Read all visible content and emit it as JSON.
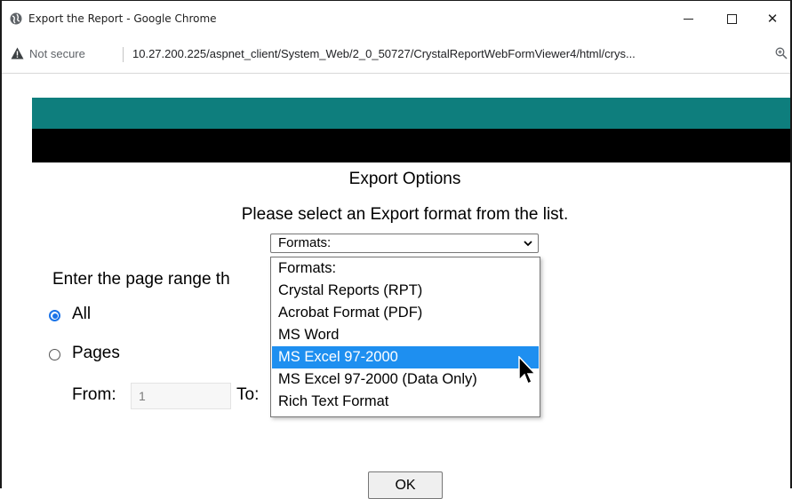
{
  "window": {
    "title": "Export the Report - Google Chrome",
    "icon": "chrome-globe-icon"
  },
  "address_bar": {
    "security_label": "Not secure",
    "url": "10.27.200.225/aspnet_client/System_Web/2_0_50727/CrystalReportWebFormViewer4/html/crys..."
  },
  "page": {
    "title": "Export Options",
    "instructions": "Please select an Export format from the list.",
    "format_select": {
      "value": "Formats:",
      "options": [
        "Formats:",
        "Crystal Reports (RPT)",
        "Acrobat Format (PDF)",
        "MS Word",
        "MS Excel 97-2000",
        "MS Excel 97-2000 (Data Only)",
        "Rich Text Format"
      ],
      "highlighted_index": 4
    },
    "range_prompt": "Enter the page range th",
    "radio_all": "All",
    "radio_pages": "Pages",
    "from_label": "From:",
    "from_value": "1",
    "to_label": "To:",
    "ok_label": "OK"
  },
  "colors": {
    "teal_band": "#0e7e7d",
    "black_band": "#000000",
    "highlight": "#1e8ff0",
    "radio_accent": "#1a73e8"
  }
}
